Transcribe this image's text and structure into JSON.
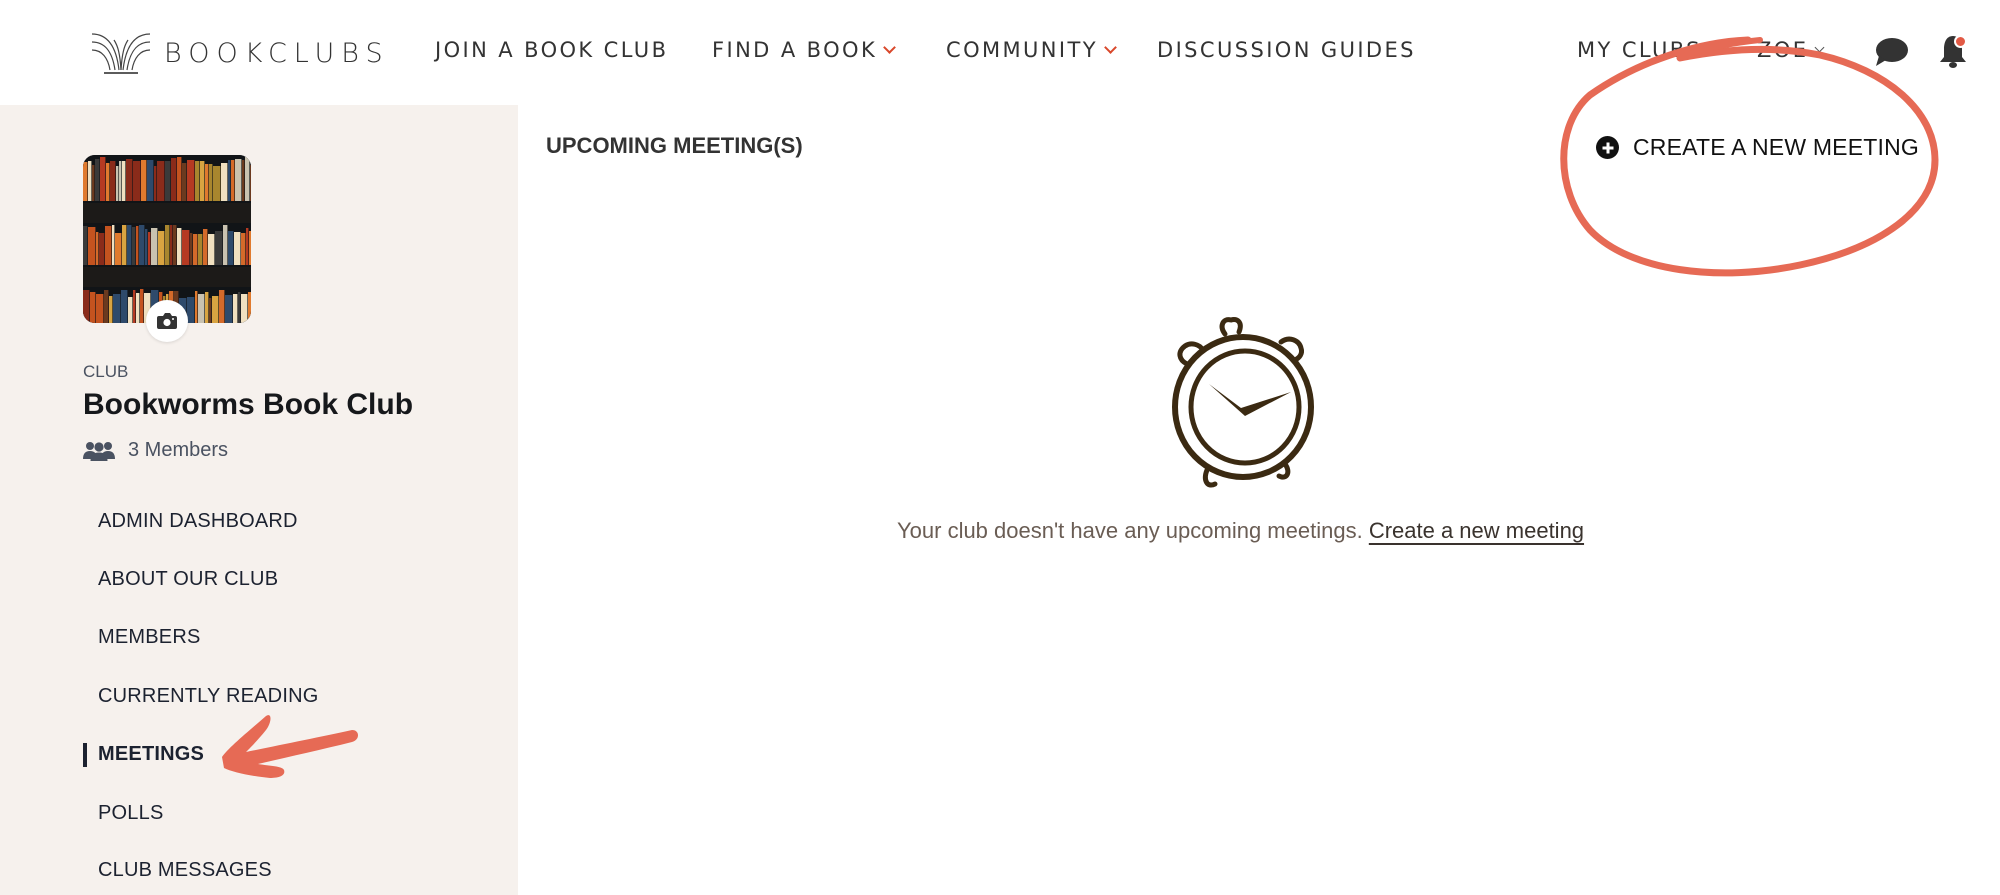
{
  "brand": {
    "name": "BOOKCLUBS",
    "accent_color": "#d9482b",
    "annotation_color": "#e66a55"
  },
  "nav": {
    "items": [
      {
        "label": "JOIN A BOOK CLUB",
        "has_dropdown": false
      },
      {
        "label": "FIND A BOOK",
        "has_dropdown": true
      },
      {
        "label": "COMMUNITY",
        "has_dropdown": true
      },
      {
        "label": "DISCUSSION GUIDES",
        "has_dropdown": false
      }
    ],
    "my_clubs": "MY CLUBS",
    "user": "ZOE",
    "icons": [
      "chat-bubble-icon",
      "bell-icon"
    ],
    "notification_dot": true
  },
  "sidebar": {
    "club_label": "CLUB",
    "club_name": "Bookworms Book Club",
    "members_label": "3 Members",
    "photo_icon": "camera-icon",
    "items": [
      {
        "label": "ADMIN DASHBOARD",
        "active": false
      },
      {
        "label": "ABOUT OUR CLUB",
        "active": false
      },
      {
        "label": "MEMBERS",
        "active": false
      },
      {
        "label": "CURRENTLY READING",
        "active": false
      },
      {
        "label": "MEETINGS",
        "active": true
      },
      {
        "label": "POLLS",
        "active": false
      },
      {
        "label": "CLUB MESSAGES",
        "active": false
      }
    ]
  },
  "main": {
    "heading": "UPCOMING MEETING(S)",
    "create_button": "CREATE A NEW MEETING",
    "empty_icon": "alarm-clock-icon",
    "empty_message": "Your club doesn't have any upcoming meetings.",
    "empty_link": "Create a new meeting"
  },
  "annotations": [
    {
      "type": "circle",
      "target": "create-a-new-meeting-button"
    },
    {
      "type": "arrow",
      "target": "sidebar-item-meetings"
    }
  ]
}
